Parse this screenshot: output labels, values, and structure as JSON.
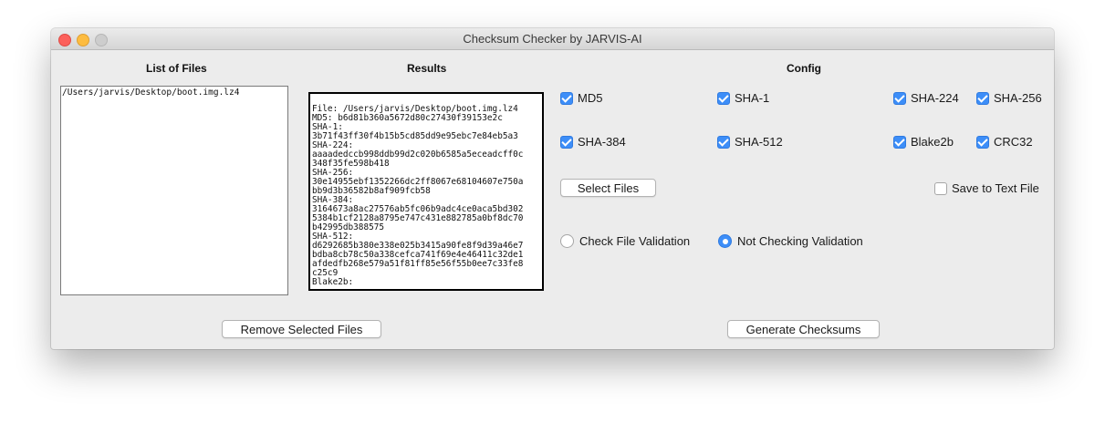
{
  "window": {
    "title": "Checksum Checker by JARVIS-AI"
  },
  "files": {
    "heading": "List of Files",
    "items": [
      "/Users/jarvis/Desktop/boot.img.lz4"
    ],
    "remove_button": "Remove Selected Files"
  },
  "results": {
    "heading": "Results",
    "text": "File: /Users/jarvis/Desktop/boot.img.lz4\nMD5: b6d81b360a5672d80c27430f39153e2c\nSHA-1:\n3b71f43ff30f4b15b5cd85dd9e95ebc7e84eb5a3\nSHA-224:\naaaadedccb998ddb99d2c020b6585a5eceadcff0c\n348f35fe598b418\nSHA-256:\n30e14955ebf1352266dc2ff8067e68104607e750a\nbb9d3b36582b8af909fcb58\nSHA-384:\n3164673a8ac27576ab5fc06b9adc4ce0aca5bd302\n5384b1cf2128a8795e747c431e882785a0bf8dc70\nb42995db388575\nSHA-512:\nd6292685b380e338e025b3415a90fe8f9d39a46e7\nbdba8cb78c50a338cefca741f69e4e46411c32de1\nafdedfb268e579a51f81ff85e56f55b0ee7c33fe8\nc25c9\nBlake2b:"
  },
  "config": {
    "heading": "Config",
    "algorithms": [
      {
        "label": "MD5",
        "checked": true
      },
      {
        "label": "SHA-1",
        "checked": true
      },
      {
        "label": "SHA-224",
        "checked": true
      },
      {
        "label": "SHA-256",
        "checked": true
      },
      {
        "label": "SHA-384",
        "checked": true
      },
      {
        "label": "SHA-512",
        "checked": true
      },
      {
        "label": "Blake2b",
        "checked": true
      },
      {
        "label": "CRC32",
        "checked": true
      }
    ],
    "select_button": "Select Files",
    "save_option": {
      "label": "Save to Text File",
      "checked": false
    },
    "validation": [
      {
        "label": "Check File Validation",
        "selected": false
      },
      {
        "label": "Not Checking Validation",
        "selected": true
      }
    ],
    "generate_button": "Generate Checksums"
  }
}
